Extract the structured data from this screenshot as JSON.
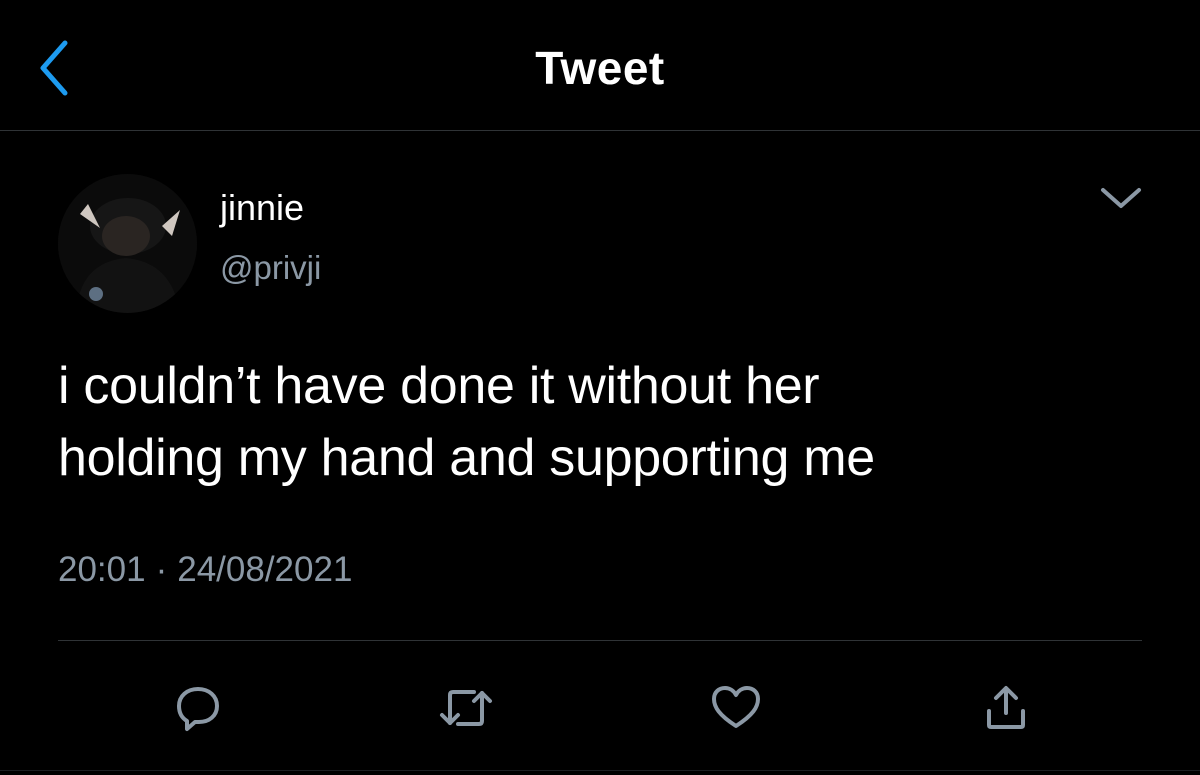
{
  "header": {
    "title": "Tweet",
    "back_icon": "chevron-left-icon"
  },
  "colors": {
    "background": "#000000",
    "text_primary": "#ffffff",
    "text_secondary": "#8b98a5",
    "accent": "#1d9bf0",
    "divider": "#2f3336"
  },
  "tweet": {
    "author": {
      "display_name": "jinnie",
      "handle": "@privji"
    },
    "text_lines": [
      "i couldn’t have done it without her",
      "holding my hand and supporting me"
    ],
    "time": "20:01",
    "separator": "·",
    "date": "24/08/2021",
    "more_icon": "chevron-down-icon"
  },
  "actions": [
    {
      "name": "reply",
      "icon": "comment-icon"
    },
    {
      "name": "retweet",
      "icon": "retweet-icon"
    },
    {
      "name": "like",
      "icon": "heart-icon"
    },
    {
      "name": "share",
      "icon": "share-icon"
    }
  ]
}
